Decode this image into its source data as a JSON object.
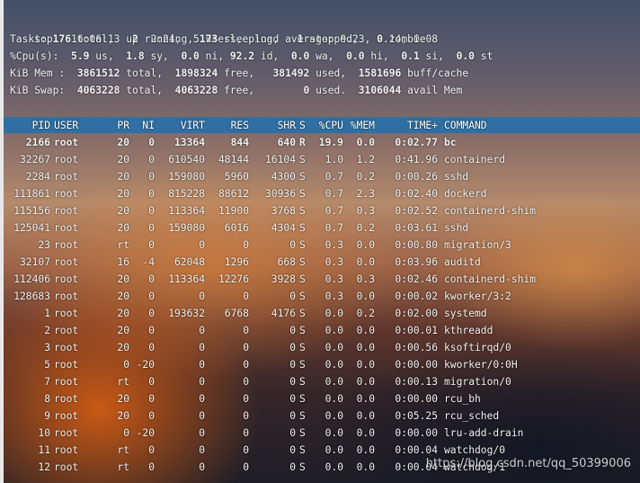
{
  "summary": {
    "line1": "top - 16:06:13 up  2:24,  5 users,  load average: 0.23, 0.14, 0.08",
    "line2_label": "Tasks: ",
    "tasks_total": "176",
    "tasks_total_label": " total,   ",
    "tasks_running": "2",
    "tasks_running_label": " running, ",
    "tasks_sleeping": "173",
    "tasks_sleeping_label": " sleeping,   ",
    "tasks_stopped": "1",
    "tasks_stopped_label": " stopped,   ",
    "tasks_zombie": "0",
    "tasks_zombie_label": " zombie",
    "line3_label": "%Cpu(s):  ",
    "cpu_us": "5.9",
    "cpu_us_label": " us,  ",
    "cpu_sy": "1.8",
    "cpu_sy_label": " sy,  ",
    "cpu_ni": "0.0",
    "cpu_ni_label": " ni, ",
    "cpu_id": "92.2",
    "cpu_id_label": " id,  ",
    "cpu_wa": "0.0",
    "cpu_wa_label": " wa,  ",
    "cpu_hi": "0.0",
    "cpu_hi_label": " hi,  ",
    "cpu_si": "0.1",
    "cpu_si_label": " si,  ",
    "cpu_st": "0.0",
    "cpu_st_label": " st",
    "line4_label": "KiB Mem :  ",
    "mem_total": "3861512",
    "mem_total_label": " total,  ",
    "mem_free": "1898324",
    "mem_free_label": " free,   ",
    "mem_used": "381492",
    "mem_used_label": " used,  ",
    "mem_buff": "1581696",
    "mem_buff_label": " buff/cache",
    "line5_label": "KiB Swap:  ",
    "swap_total": "4063228",
    "swap_total_label": " total,  ",
    "swap_free": "4063228",
    "swap_free_label": " free,        ",
    "swap_used": "0",
    "swap_used_label": " used.  ",
    "swap_avail": "3106044",
    "swap_avail_label": " avail Mem"
  },
  "columns": {
    "pid": "PID",
    "user": "USER",
    "pr": "PR",
    "ni": "NI",
    "virt": "VIRT",
    "res": "RES",
    "shr": "SHR",
    "s": "S",
    "cpu": "%CPU",
    "mem": "%MEM",
    "time": "TIME+",
    "command": "COMMAND"
  },
  "processes": [
    {
      "pid": "2166",
      "user": "root",
      "pr": "20",
      "ni": "0",
      "virt": "13364",
      "res": "844",
      "shr": "640",
      "s": "R",
      "cpu": "19.9",
      "mem": "0.0",
      "time": "0:02.77",
      "command": "bc"
    },
    {
      "pid": "32267",
      "user": "root",
      "pr": "20",
      "ni": "0",
      "virt": "610540",
      "res": "48144",
      "shr": "16104",
      "s": "S",
      "cpu": "1.0",
      "mem": "1.2",
      "time": "0:41.96",
      "command": "containerd"
    },
    {
      "pid": "2284",
      "user": "root",
      "pr": "20",
      "ni": "0",
      "virt": "159080",
      "res": "5960",
      "shr": "4300",
      "s": "S",
      "cpu": "0.7",
      "mem": "0.2",
      "time": "0:00.26",
      "command": "sshd"
    },
    {
      "pid": "111861",
      "user": "root",
      "pr": "20",
      "ni": "0",
      "virt": "815228",
      "res": "88612",
      "shr": "30936",
      "s": "S",
      "cpu": "0.7",
      "mem": "2.3",
      "time": "0:02.40",
      "command": "dockerd"
    },
    {
      "pid": "115156",
      "user": "root",
      "pr": "20",
      "ni": "0",
      "virt": "113364",
      "res": "11900",
      "shr": "3768",
      "s": "S",
      "cpu": "0.7",
      "mem": "0.3",
      "time": "0:02.52",
      "command": "containerd-shim"
    },
    {
      "pid": "125041",
      "user": "root",
      "pr": "20",
      "ni": "0",
      "virt": "159080",
      "res": "6016",
      "shr": "4304",
      "s": "S",
      "cpu": "0.7",
      "mem": "0.2",
      "time": "0:03.61",
      "command": "sshd"
    },
    {
      "pid": "23",
      "user": "root",
      "pr": "rt",
      "ni": "0",
      "virt": "0",
      "res": "0",
      "shr": "0",
      "s": "S",
      "cpu": "0.3",
      "mem": "0.0",
      "time": "0:00.80",
      "command": "migration/3"
    },
    {
      "pid": "32107",
      "user": "root",
      "pr": "16",
      "ni": "-4",
      "virt": "62048",
      "res": "1296",
      "shr": "668",
      "s": "S",
      "cpu": "0.3",
      "mem": "0.0",
      "time": "0:03.96",
      "command": "auditd"
    },
    {
      "pid": "112406",
      "user": "root",
      "pr": "20",
      "ni": "0",
      "virt": "113364",
      "res": "12276",
      "shr": "3928",
      "s": "S",
      "cpu": "0.3",
      "mem": "0.3",
      "time": "0:02.46",
      "command": "containerd-shim"
    },
    {
      "pid": "128683",
      "user": "root",
      "pr": "20",
      "ni": "0",
      "virt": "0",
      "res": "0",
      "shr": "0",
      "s": "S",
      "cpu": "0.3",
      "mem": "0.0",
      "time": "0:00.02",
      "command": "kworker/3:2"
    },
    {
      "pid": "1",
      "user": "root",
      "pr": "20",
      "ni": "0",
      "virt": "193632",
      "res": "6768",
      "shr": "4176",
      "s": "S",
      "cpu": "0.0",
      "mem": "0.2",
      "time": "0:02.00",
      "command": "systemd"
    },
    {
      "pid": "2",
      "user": "root",
      "pr": "20",
      "ni": "0",
      "virt": "0",
      "res": "0",
      "shr": "0",
      "s": "S",
      "cpu": "0.0",
      "mem": "0.0",
      "time": "0:00.01",
      "command": "kthreadd"
    },
    {
      "pid": "3",
      "user": "root",
      "pr": "20",
      "ni": "0",
      "virt": "0",
      "res": "0",
      "shr": "0",
      "s": "S",
      "cpu": "0.0",
      "mem": "0.0",
      "time": "0:00.56",
      "command": "ksoftirqd/0"
    },
    {
      "pid": "5",
      "user": "root",
      "pr": "0",
      "ni": "-20",
      "virt": "0",
      "res": "0",
      "shr": "0",
      "s": "S",
      "cpu": "0.0",
      "mem": "0.0",
      "time": "0:00.00",
      "command": "kworker/0:0H"
    },
    {
      "pid": "7",
      "user": "root",
      "pr": "rt",
      "ni": "0",
      "virt": "0",
      "res": "0",
      "shr": "0",
      "s": "S",
      "cpu": "0.0",
      "mem": "0.0",
      "time": "0:00.13",
      "command": "migration/0"
    },
    {
      "pid": "8",
      "user": "root",
      "pr": "20",
      "ni": "0",
      "virt": "0",
      "res": "0",
      "shr": "0",
      "s": "S",
      "cpu": "0.0",
      "mem": "0.0",
      "time": "0:00.00",
      "command": "rcu_bh"
    },
    {
      "pid": "9",
      "user": "root",
      "pr": "20",
      "ni": "0",
      "virt": "0",
      "res": "0",
      "shr": "0",
      "s": "S",
      "cpu": "0.0",
      "mem": "0.0",
      "time": "0:05.25",
      "command": "rcu_sched"
    },
    {
      "pid": "10",
      "user": "root",
      "pr": "0",
      "ni": "-20",
      "virt": "0",
      "res": "0",
      "shr": "0",
      "s": "S",
      "cpu": "0.0",
      "mem": "0.0",
      "time": "0:00.00",
      "command": "lru-add-drain"
    },
    {
      "pid": "11",
      "user": "root",
      "pr": "rt",
      "ni": "0",
      "virt": "0",
      "res": "0",
      "shr": "0",
      "s": "S",
      "cpu": "0.0",
      "mem": "0.0",
      "time": "0:00.04",
      "command": "watchdog/0"
    },
    {
      "pid": "12",
      "user": "root",
      "pr": "rt",
      "ni": "0",
      "virt": "0",
      "res": "0",
      "shr": "0",
      "s": "S",
      "cpu": "0.0",
      "mem": "0.0",
      "time": "0:00.04",
      "command": "watchdog/1"
    }
  ],
  "watermark": "https://blog.csdn.net/qq_50399006"
}
